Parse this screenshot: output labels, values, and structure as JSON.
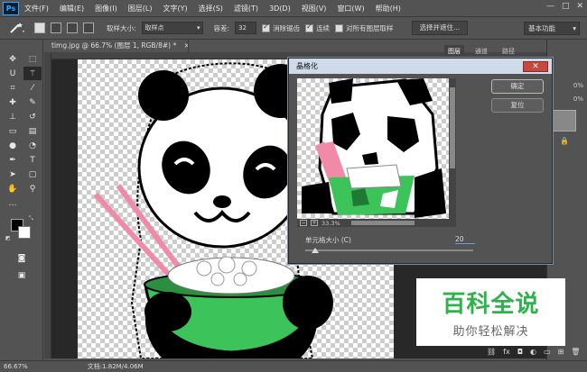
{
  "app": {
    "logo": "Ps"
  },
  "menu": [
    "文件(F)",
    "编辑(E)",
    "图像(I)",
    "图层(L)",
    "文字(Y)",
    "选择(S)",
    "滤镜(T)",
    "3D(D)",
    "视图(V)",
    "窗口(W)",
    "帮助(H)"
  ],
  "window_controls": {
    "minimize": "—",
    "maximize": "□",
    "close": "✕"
  },
  "options": {
    "tool_icon": "magic-wand-icon",
    "sample_size_label": "取样大小:",
    "sample_size_value": "取样点",
    "tolerance_label": "容差:",
    "tolerance_value": "32",
    "antialias_label": "消除锯齿",
    "contiguous_label": "连续",
    "sample_all_label": "对所有图层取样",
    "refine_button": "选择并遮住...",
    "workspace": "基本功能"
  },
  "document": {
    "tab_title": "timg.jpg @ 66.7% (图层 1, RGB/8#) *",
    "tab_close": "×"
  },
  "status": {
    "zoom": "66.67%",
    "doc_info": "文档:1.82M/4.06M"
  },
  "panels": {
    "tabs": [
      "图层",
      "通道",
      "路径"
    ],
    "active_tab": "图层",
    "pct1": "0%",
    "pct2": "0%"
  },
  "dialog": {
    "title": "晶格化",
    "ok": "确定",
    "reset": "复位",
    "zoom_text": "33.3%",
    "zoom_minus": "−",
    "zoom_plus": "+",
    "cell_size_label": "单元格大小 (C)",
    "cell_size_value": "20",
    "cell_size_min": 3,
    "cell_size_max": 300
  },
  "watermark": {
    "title": "百科全说",
    "subtitle": "助你轻松解决"
  },
  "colors": {
    "accent": "#31a8ff",
    "watermark_green": "#2eb24a",
    "bowl_green": "#3cc35a"
  }
}
